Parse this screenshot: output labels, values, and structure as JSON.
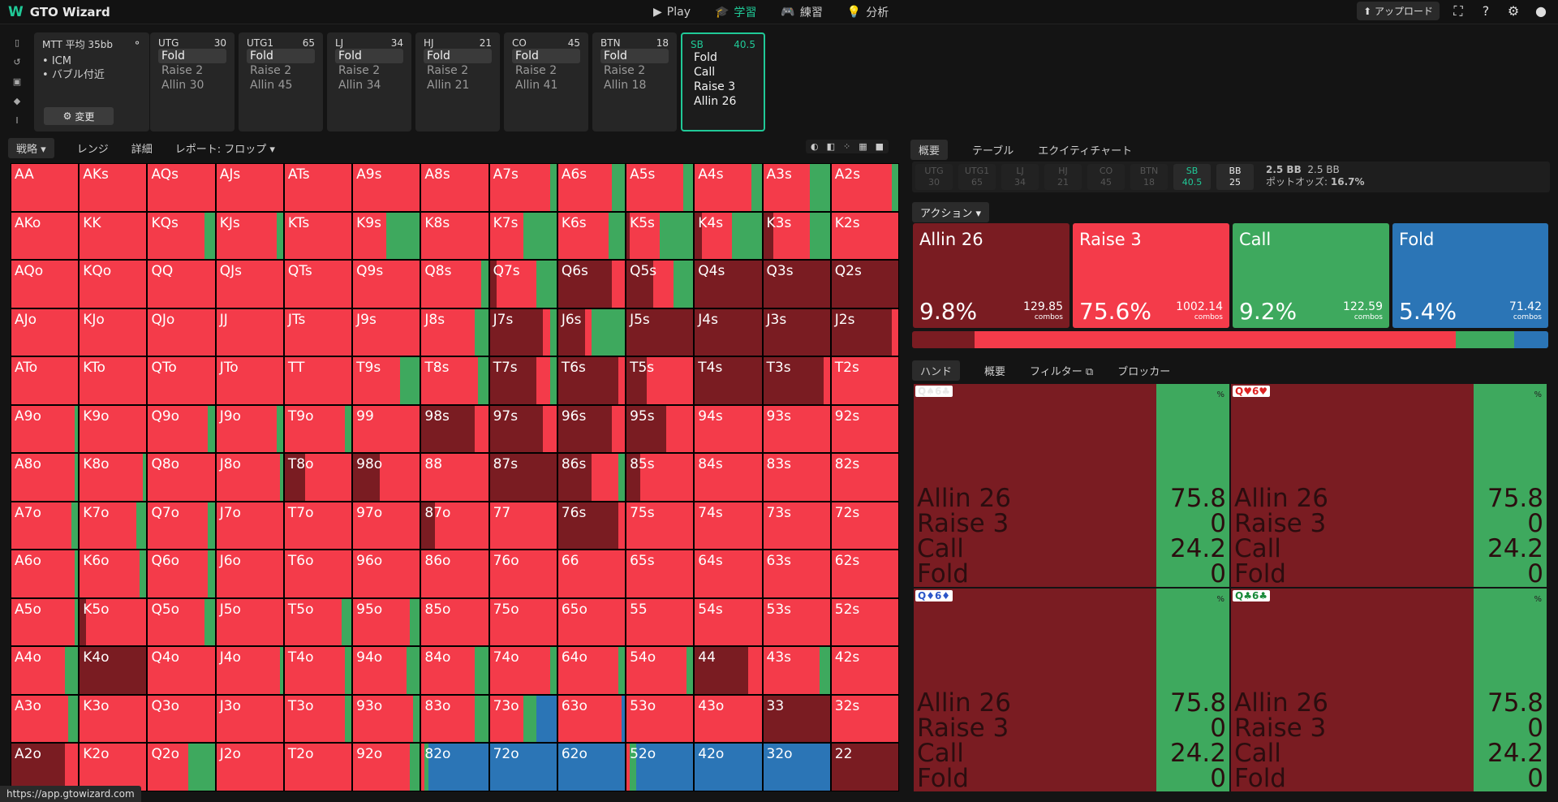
{
  "app": {
    "title": "GTO Wizard"
  },
  "nav": [
    {
      "label": "Play",
      "icon": "play-icon",
      "active": false
    },
    {
      "label": "学習",
      "icon": "graduation-cap-icon",
      "active": true
    },
    {
      "label": "練習",
      "icon": "gamepad-icon",
      "active": false
    },
    {
      "label": "分析",
      "icon": "lightbulb-icon",
      "active": false
    }
  ],
  "topright": {
    "upload": "アップロード"
  },
  "mtt": {
    "title": "MTT 平均 35bb",
    "bullets": [
      "ICM",
      "バブル付近"
    ],
    "change": "変更"
  },
  "positions": [
    {
      "name": "UTG",
      "stack": "30",
      "actions": [
        "Fold",
        "Raise 2",
        "Allin 30"
      ],
      "selected": 0
    },
    {
      "name": "UTG1",
      "stack": "65",
      "actions": [
        "Fold",
        "Raise 2",
        "Allin 45"
      ],
      "selected": 0
    },
    {
      "name": "LJ",
      "stack": "34",
      "actions": [
        "Fold",
        "Raise 2",
        "Allin 34"
      ],
      "selected": 0
    },
    {
      "name": "HJ",
      "stack": "21",
      "actions": [
        "Fold",
        "Raise 2",
        "Allin 21"
      ],
      "selected": 0
    },
    {
      "name": "CO",
      "stack": "45",
      "actions": [
        "Fold",
        "Raise 2",
        "Allin 41"
      ],
      "selected": 0
    },
    {
      "name": "BTN",
      "stack": "18",
      "actions": [
        "Fold",
        "Raise 2",
        "Allin 18"
      ],
      "selected": 0
    }
  ],
  "sb_card": {
    "name": "SB",
    "stack": "40.5",
    "actions": [
      "Fold",
      "Call",
      "Raise 3",
      "Allin 26"
    ]
  },
  "left_tabs": [
    "戦略",
    "レンジ",
    "詳細",
    "レポート: フロップ"
  ],
  "right_tabs": [
    "概要",
    "テーブル",
    "エクイティチャート"
  ],
  "posbar": [
    {
      "n": "UTG",
      "s": "30"
    },
    {
      "n": "UTG1",
      "s": "65"
    },
    {
      "n": "LJ",
      "s": "34"
    },
    {
      "n": "HJ",
      "s": "21"
    },
    {
      "n": "CO",
      "s": "45"
    },
    {
      "n": "BTN",
      "s": "18"
    },
    {
      "n": "SB",
      "s": "40.5"
    },
    {
      "n": "BB",
      "s": "25"
    }
  ],
  "pot": {
    "bb1": "2.5 BB",
    "bb2": "2.5 BB",
    "odds_label": "ポットオッズ:",
    "odds": "16.7%"
  },
  "action_dropdown": "アクション",
  "actions": [
    {
      "name": "Allin 26",
      "pct": "9.8%",
      "combos": "129.85",
      "color": "#7a1c22"
    },
    {
      "name": "Raise 3",
      "pct": "75.6%",
      "combos": "1002.14",
      "color": "#f43b4a"
    },
    {
      "name": "Call",
      "pct": "9.2%",
      "combos": "122.59",
      "color": "#3ea95e"
    },
    {
      "name": "Fold",
      "pct": "5.4%",
      "combos": "71.42",
      "color": "#2b75b6"
    }
  ],
  "combos_word": "combos",
  "hand_tabs": [
    "ハンド",
    "概要",
    "フィルター",
    "ブロッカー"
  ],
  "hands": [
    {
      "tag": "Q♠6♣",
      "rows": [
        [
          "Allin 26",
          "75.8"
        ],
        [
          "Raise 3",
          "0"
        ],
        [
          "Call",
          "24.2"
        ],
        [
          "Fold",
          "0"
        ]
      ]
    },
    {
      "tag": "Q♥6♥",
      "rows": [
        [
          "Allin 26",
          "75.8"
        ],
        [
          "Raise 3",
          "0"
        ],
        [
          "Call",
          "24.2"
        ],
        [
          "Fold",
          "0"
        ]
      ]
    },
    {
      "tag": "Q♦6♦",
      "rows": [
        [
          "Allin 26",
          "75.8"
        ],
        [
          "Raise 3",
          "0"
        ],
        [
          "Call",
          "24.2"
        ],
        [
          "Fold",
          "0"
        ]
      ]
    },
    {
      "tag": "Q♣6♣",
      "rows": [
        [
          "Allin 26",
          "75.8"
        ],
        [
          "Raise 3",
          "0"
        ],
        [
          "Call",
          "24.2"
        ],
        [
          "Fold",
          "0"
        ]
      ]
    }
  ],
  "pct_symbol": "%",
  "status_url": "https://app.gtowizard.com",
  "matrix": [
    [
      "AA",
      "AKs",
      "AQs",
      "AJs",
      "ATs",
      "A9s",
      "A8s",
      "A7s",
      "A6s",
      "A5s",
      "A4s",
      "A3s",
      "A2s"
    ],
    [
      "AKo",
      "KK",
      "KQs",
      "KJs",
      "KTs",
      "K9s",
      "K8s",
      "K7s",
      "K6s",
      "K5s",
      "K4s",
      "K3s",
      "K2s"
    ],
    [
      "AQo",
      "KQo",
      "QQ",
      "QJs",
      "QTs",
      "Q9s",
      "Q8s",
      "Q7s",
      "Q6s",
      "Q5s",
      "Q4s",
      "Q3s",
      "Q2s"
    ],
    [
      "AJo",
      "KJo",
      "QJo",
      "JJ",
      "JTs",
      "J9s",
      "J8s",
      "J7s",
      "J6s",
      "J5s",
      "J4s",
      "J3s",
      "J2s"
    ],
    [
      "ATo",
      "KTo",
      "QTo",
      "JTo",
      "TT",
      "T9s",
      "T8s",
      "T7s",
      "T6s",
      "T5s",
      "T4s",
      "T3s",
      "T2s"
    ],
    [
      "A9o",
      "K9o",
      "Q9o",
      "J9o",
      "T9o",
      "99",
      "98s",
      "97s",
      "96s",
      "95s",
      "94s",
      "93s",
      "92s"
    ],
    [
      "A8o",
      "K8o",
      "Q8o",
      "J8o",
      "T8o",
      "98o",
      "88",
      "87s",
      "86s",
      "85s",
      "84s",
      "83s",
      "82s"
    ],
    [
      "A7o",
      "K7o",
      "Q7o",
      "J7o",
      "T7o",
      "97o",
      "87o",
      "77",
      "76s",
      "75s",
      "74s",
      "73s",
      "72s"
    ],
    [
      "A6o",
      "K6o",
      "Q6o",
      "J6o",
      "T6o",
      "96o",
      "86o",
      "76o",
      "66",
      "65s",
      "64s",
      "63s",
      "62s"
    ],
    [
      "A5o",
      "K5o",
      "Q5o",
      "J5o",
      "T5o",
      "95o",
      "85o",
      "75o",
      "65o",
      "55",
      "54s",
      "53s",
      "52s"
    ],
    [
      "A4o",
      "K4o",
      "Q4o",
      "J4o",
      "T4o",
      "94o",
      "84o",
      "74o",
      "64o",
      "54o",
      "44",
      "43s",
      "42s"
    ],
    [
      "A3o",
      "K3o",
      "Q3o",
      "J3o",
      "T3o",
      "93o",
      "83o",
      "73o",
      "63o",
      "53o",
      "43o",
      "33",
      "32s"
    ],
    [
      "A2o",
      "K2o",
      "Q2o",
      "J2o",
      "T2o",
      "92o",
      "82o",
      "72o",
      "62o",
      "52o",
      "42o",
      "32o",
      "22"
    ]
  ],
  "matrix_mix": {
    "A7s": {
      "r": 0.9,
      "c": 0.1
    },
    "A6s": {
      "r": 0.8,
      "c": 0.2
    },
    "A5s": {
      "r": 0.85,
      "c": 0.15
    },
    "A4s": {
      "r": 0.85,
      "c": 0.15
    },
    "A3s": {
      "r": 0.7,
      "c": 0.3
    },
    "A2s": {
      "r": 0.9,
      "c": 0.1
    },
    "KQs": {
      "r": 0.85,
      "c": 0.15
    },
    "KJs": {
      "r": 0.9,
      "c": 0.1
    },
    "K9s": {
      "r": 0.5,
      "c": 0.5
    },
    "K7s": {
      "r": 0.5,
      "c": 0.5
    },
    "K6s": {
      "r": 0.75,
      "c": 0.25
    },
    "K5s": {
      "a": 0.05,
      "r": 0.45,
      "c": 0.5
    },
    "K4s": {
      "a": 0.1,
      "r": 0.45,
      "c": 0.45
    },
    "K3s": {
      "a": 0.15,
      "r": 0.55,
      "c": 0.3
    },
    "Q8s": {
      "r": 0.9,
      "c": 0.1
    },
    "Q7s": {
      "a": 0.1,
      "r": 0.6,
      "c": 0.3
    },
    "Q6s": {
      "a": 0.8,
      "r": 0.2
    },
    "Q5s": {
      "a": 0.4,
      "r": 0.3,
      "c": 0.3
    },
    "Q4s": {
      "a": 1
    },
    "Q3s": {
      "a": 1
    },
    "Q2s": {
      "a": 1
    },
    "J8s": {
      "r": 0.8,
      "c": 0.2
    },
    "J7s": {
      "a": 0.8,
      "r": 0.1,
      "c": 0.1
    },
    "J6s": {
      "a": 0.4,
      "r": 0.1,
      "c": 0.5
    },
    "J5s": {
      "a": 1
    },
    "J4s": {
      "a": 1
    },
    "J3s": {
      "a": 1
    },
    "J2s": {
      "a": 0.9,
      "r": 0.1
    },
    "T9s": {
      "r": 0.7,
      "c": 0.3
    },
    "T8s": {
      "r": 0.85,
      "c": 0.15
    },
    "T7s": {
      "a": 0.7,
      "r": 0.2,
      "c": 0.1
    },
    "T6s": {
      "a": 0.9,
      "r": 0.1
    },
    "T5s": {
      "a": 0.3,
      "r": 0.7
    },
    "T4s": {
      "a": 1
    },
    "T3s": {
      "a": 0.9,
      "r": 0.1
    },
    "98s": {
      "a": 0.8,
      "r": 0.2
    },
    "97s": {
      "a": 0.8,
      "r": 0.2
    },
    "96s": {
      "a": 0.8,
      "r": 0.2
    },
    "95s": {
      "a": 0.6,
      "r": 0.4
    },
    "86s": {
      "a": 0.5,
      "r": 0.4,
      "c": 0.1
    },
    "85s": {
      "a": 0.2,
      "r": 0.8
    },
    "87s": {
      "a": 1
    },
    "76s": {
      "a": 0.9,
      "r": 0.1
    },
    "T8o": {
      "a": 0.3,
      "r": 0.7
    },
    "98o": {
      "a": 0.4,
      "r": 0.6
    },
    "87o": {
      "a": 0.2,
      "r": 0.8
    },
    "J9o": {
      "r": 0.9,
      "c": 0.1
    },
    "Q9o": {
      "r": 0.9,
      "c": 0.1
    },
    "T9o": {
      "r": 0.9,
      "c": 0.1
    },
    "K8o": {
      "r": 0.95,
      "c": 0.05
    },
    "A9o": {
      "r": 0.95,
      "c": 0.05
    },
    "A8o": {
      "r": 0.95,
      "c": 0.05
    },
    "A7o": {
      "r": 0.9,
      "c": 0.1
    },
    "A6o": {
      "r": 0.95,
      "c": 0.05
    },
    "A5o": {
      "r": 0.95,
      "c": 0.05
    },
    "K5o": {
      "a": 0.1,
      "r": 0.9
    },
    "K4o": {
      "a": 1
    },
    "K7o": {
      "r": 0.85,
      "c": 0.15
    },
    "K6o": {
      "r": 0.9,
      "c": 0.1
    },
    "A4o": {
      "r": 0.8,
      "c": 0.2
    },
    "A3o": {
      "r": 0.85,
      "c": 0.15
    },
    "A2o": {
      "a": 0.8,
      "r": 0.2
    },
    "J8o": {
      "r": 0.95,
      "c": 0.05
    },
    "Q7o": {
      "r": 0.9,
      "c": 0.1
    },
    "Q5o": {
      "r": 0.85,
      "c": 0.15
    },
    "T5o": {
      "r": 0.85,
      "c": 0.15
    },
    "95o": {
      "r": 0.85,
      "c": 0.15
    },
    "94o": {
      "r": 0.8,
      "c": 0.2
    },
    "93o": {
      "r": 0.9,
      "c": 0.1
    },
    "92o": {
      "r": 0.85,
      "c": 0.15
    },
    "Q6o": {
      "r": 0.9,
      "c": 0.1
    },
    "Q2o": {
      "r": 0.6,
      "c": 0.4
    },
    "T4o": {
      "r": 0.9,
      "c": 0.1
    },
    "T3o": {
      "r": 0.9,
      "c": 0.1
    },
    "84o": {
      "r": 0.8,
      "c": 0.2
    },
    "74o": {
      "r": 0.9,
      "c": 0.1
    },
    "64o": {
      "r": 0.9,
      "c": 0.1
    },
    "54o": {
      "r": 0.9,
      "c": 0.1
    },
    "83o": {
      "r": 0.8,
      "c": 0.2
    },
    "43s": {
      "r": 0.85,
      "c": 0.15
    },
    "44": {
      "a": 0.8,
      "r": 0.2
    },
    "33": {
      "a": 1
    },
    "22": {
      "a": 1
    },
    "73o": {
      "r": 0.5,
      "c": 0.2,
      "f": 0.3
    },
    "63o": {
      "r": 0.95,
      "f": 0.05
    },
    "82o": {
      "r": 0.05,
      "c": 0.05,
      "f": 0.9
    },
    "72o": {
      "f": 1
    },
    "62o": {
      "f": 1
    },
    "52o": {
      "r": 0.05,
      "c": 0.1,
      "f": 0.85
    },
    "42o": {
      "f": 1
    },
    "32o": {
      "f": 1
    },
    "T2s": {
      "r": 1
    },
    "J4o": {
      "r": 0.95,
      "c": 0.05
    }
  }
}
